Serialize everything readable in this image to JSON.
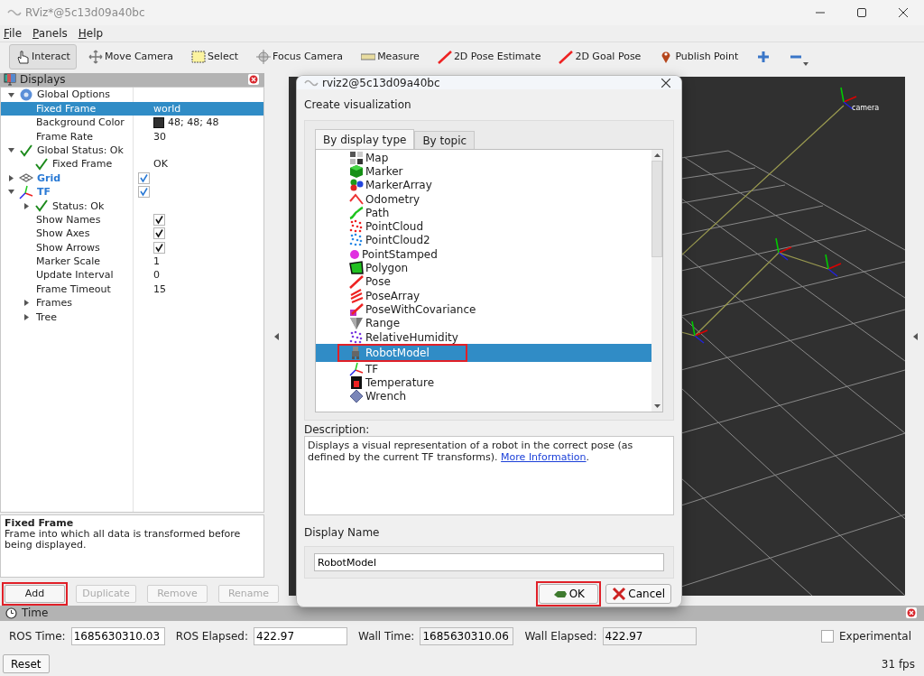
{
  "window": {
    "title": "RViz*@5c13d09a40bc"
  },
  "menu": [
    {
      "label": "File"
    },
    {
      "label": "Panels"
    },
    {
      "label": "Help"
    }
  ],
  "toolbar": [
    {
      "label": "Interact",
      "kind": "interact",
      "selected": true
    },
    {
      "label": "Move Camera",
      "kind": "move",
      "selected": false
    },
    {
      "label": "Select",
      "kind": "select",
      "selected": false
    },
    {
      "label": "Focus Camera",
      "kind": "focus",
      "selected": false
    },
    {
      "label": "Measure",
      "kind": "measure",
      "selected": false
    },
    {
      "label": "2D Pose Estimate",
      "kind": "pose",
      "selected": false
    },
    {
      "label": "2D Goal Pose",
      "kind": "goal",
      "selected": false
    },
    {
      "label": "Publish Point",
      "kind": "point",
      "selected": false
    },
    {
      "kind": "add",
      "selected": false
    },
    {
      "kind": "remove",
      "selected": false
    }
  ],
  "displays": {
    "title": "Displays",
    "tree": [
      {
        "kind": "group",
        "label": "Global Options",
        "expanded": true,
        "selected": false,
        "children": [
          {
            "kind": "property",
            "label": "Fixed Frame",
            "value": "world",
            "selected": true
          },
          {
            "kind": "property",
            "label": "Background Color",
            "value": "48; 48; 48",
            "color": "#303030",
            "selected": false
          },
          {
            "kind": "property",
            "label": "Frame Rate",
            "value": "30",
            "selected": false
          }
        ]
      },
      {
        "kind": "status",
        "label": "Global Status: Ok",
        "expanded": true,
        "selected": false,
        "children": [
          {
            "kind": "status",
            "label": "Fixed Frame",
            "value": "OK",
            "selected": false
          }
        ]
      },
      {
        "kind": "grid",
        "label": "Grid",
        "expanded": false,
        "checked": true,
        "selected": false
      },
      {
        "kind": "tf",
        "label": "TF",
        "expanded": true,
        "checked": true,
        "selected": false,
        "children": [
          {
            "kind": "status",
            "label": "Status: Ok",
            "expanded": false,
            "selected": false
          },
          {
            "kind": "property",
            "label": "Show Names",
            "checked": true,
            "selected": false
          },
          {
            "kind": "property",
            "label": "Show Axes",
            "checked": true,
            "selected": false
          },
          {
            "kind": "property",
            "label": "Show Arrows",
            "checked": true,
            "selected": false
          },
          {
            "kind": "property",
            "label": "Marker Scale",
            "value": "1",
            "selected": false
          },
          {
            "kind": "property",
            "label": "Update Interval",
            "value": "0",
            "selected": false
          },
          {
            "kind": "property",
            "label": "Frame Timeout",
            "value": "15",
            "selected": false
          },
          {
            "kind": "property",
            "label": "Frames",
            "expanded": false,
            "selected": false
          },
          {
            "kind": "property",
            "label": "Tree",
            "expanded": false,
            "selected": false
          }
        ]
      }
    ],
    "description": {
      "title": "Fixed Frame",
      "text": "Frame into which all data is transformed before being displayed."
    },
    "buttons": [
      {
        "label": "Add",
        "disabled": false,
        "highlighted": true
      },
      {
        "label": "Duplicate",
        "disabled": true,
        "highlighted": false
      },
      {
        "label": "Remove",
        "disabled": true,
        "highlighted": false
      },
      {
        "label": "Rename",
        "disabled": true,
        "highlighted": false
      }
    ]
  },
  "view": {
    "frame_label": "camera"
  },
  "dialog": {
    "title": "rviz2@5c13d09a40bc",
    "heading": "Create visualization",
    "tabs": [
      {
        "label": "By display type",
        "selected": true
      },
      {
        "label": "By topic",
        "selected": false
      }
    ],
    "items": [
      {
        "label": "Map",
        "kind": "map",
        "selected": false,
        "highlighted": false
      },
      {
        "label": "Marker",
        "kind": "marker",
        "selected": false,
        "highlighted": false
      },
      {
        "label": "MarkerArray",
        "kind": "markerarray",
        "selected": false,
        "highlighted": false
      },
      {
        "label": "Odometry",
        "kind": "odometry",
        "selected": false,
        "highlighted": false
      },
      {
        "label": "Path",
        "kind": "path",
        "selected": false,
        "highlighted": false
      },
      {
        "label": "PointCloud",
        "kind": "pointcloud",
        "selected": false,
        "highlighted": false
      },
      {
        "label": "PointCloud2",
        "kind": "pointcloud2",
        "selected": false,
        "highlighted": false
      },
      {
        "label": "PointStamped",
        "kind": "pointstamped",
        "selected": false,
        "highlighted": false
      },
      {
        "label": "Polygon",
        "kind": "polygon",
        "selected": false,
        "highlighted": false
      },
      {
        "label": "Pose",
        "kind": "pose",
        "selected": false,
        "highlighted": false
      },
      {
        "label": "PoseArray",
        "kind": "posearray",
        "selected": false,
        "highlighted": false
      },
      {
        "label": "PoseWithCovariance",
        "kind": "posecov",
        "selected": false,
        "highlighted": false
      },
      {
        "label": "Range",
        "kind": "range",
        "selected": false,
        "highlighted": false
      },
      {
        "label": "RelativeHumidity",
        "kind": "humidity",
        "selected": false,
        "highlighted": false
      },
      {
        "label": "RobotModel",
        "kind": "robot",
        "selected": true,
        "highlighted": true
      },
      {
        "label": "TF",
        "kind": "tf",
        "selected": false,
        "highlighted": false
      },
      {
        "label": "Temperature",
        "kind": "temperature",
        "selected": false,
        "highlighted": false
      },
      {
        "label": "Wrench",
        "kind": "wrench",
        "selected": false,
        "highlighted": false
      }
    ],
    "description_label": "Description:",
    "description": {
      "text": "Displays a visual representation of a robot in the correct pose (as defined by the current TF transforms). ",
      "link": "More Information",
      "after": "."
    },
    "display_name_label": "Display Name",
    "display_name": "RobotModel",
    "buttons": [
      {
        "label": "OK",
        "kind": "ok",
        "highlighted": true
      },
      {
        "label": "Cancel",
        "kind": "cancel",
        "highlighted": false
      }
    ]
  },
  "time": {
    "title": "Time",
    "fields": [
      {
        "label": "ROS Time:",
        "value": "1685630310.03",
        "readonly": false
      },
      {
        "label": "ROS Elapsed:",
        "value": "422.97",
        "readonly": false
      },
      {
        "label": "Wall Time:",
        "value": "1685630310.06",
        "readonly": true
      },
      {
        "label": "Wall Elapsed:",
        "value": "422.97",
        "readonly": true
      }
    ],
    "reset": "Reset",
    "experimental": {
      "label": "Experimental",
      "checked": false
    },
    "fps": "31 fps"
  }
}
